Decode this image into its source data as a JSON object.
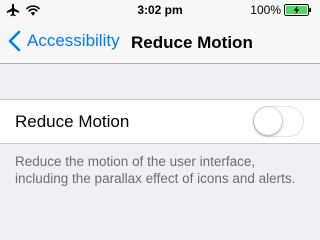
{
  "status_bar": {
    "time": "3:02 pm",
    "battery_percent": "100%",
    "signal_dots": 5,
    "battery_level": 1.0,
    "battery_color": "#4cd964"
  },
  "nav": {
    "back_label": "Accessibility",
    "title": "Reduce Motion",
    "back_icon": "chevron-left-icon"
  },
  "setting": {
    "label": "Reduce Motion",
    "enabled": false,
    "description": "Reduce the motion of the user interface, including the parallax effect of icons and alerts."
  },
  "colors": {
    "accent": "#007aff",
    "background": "#efeff4",
    "secondary_text": "#6d6d72"
  }
}
